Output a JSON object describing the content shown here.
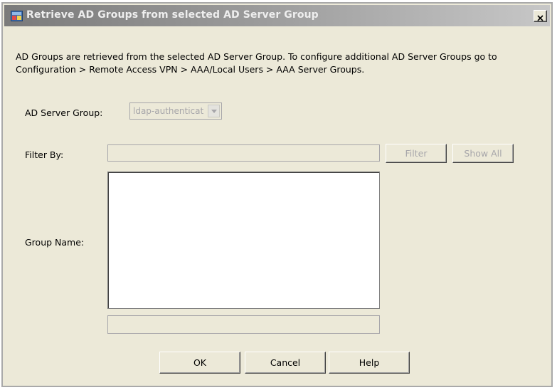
{
  "dialog": {
    "title": "Retrieve AD Groups from selected AD Server Group",
    "close_label": "x",
    "description": "AD Groups are retrieved from the selected AD Server Group. To configure additional AD Server Groups go to Configuration > Remote Access VPN > AAA/Local Users > AAA Server Groups."
  },
  "ad_server_group": {
    "label": "AD Server Group:",
    "selected": "ldap-authenticat"
  },
  "filter": {
    "label": "Filter By:",
    "value": "",
    "filter_button": "Filter",
    "show_all_button": "Show All"
  },
  "group_name": {
    "label": "Group Name:",
    "items": [],
    "value": ""
  },
  "buttons": {
    "ok": "OK",
    "cancel": "Cancel",
    "help": "Help"
  },
  "colors": {
    "dialog_bg": "#ece9d8",
    "titlebar": "#9a9a9a",
    "disabled_text": "#a7a6aa"
  }
}
